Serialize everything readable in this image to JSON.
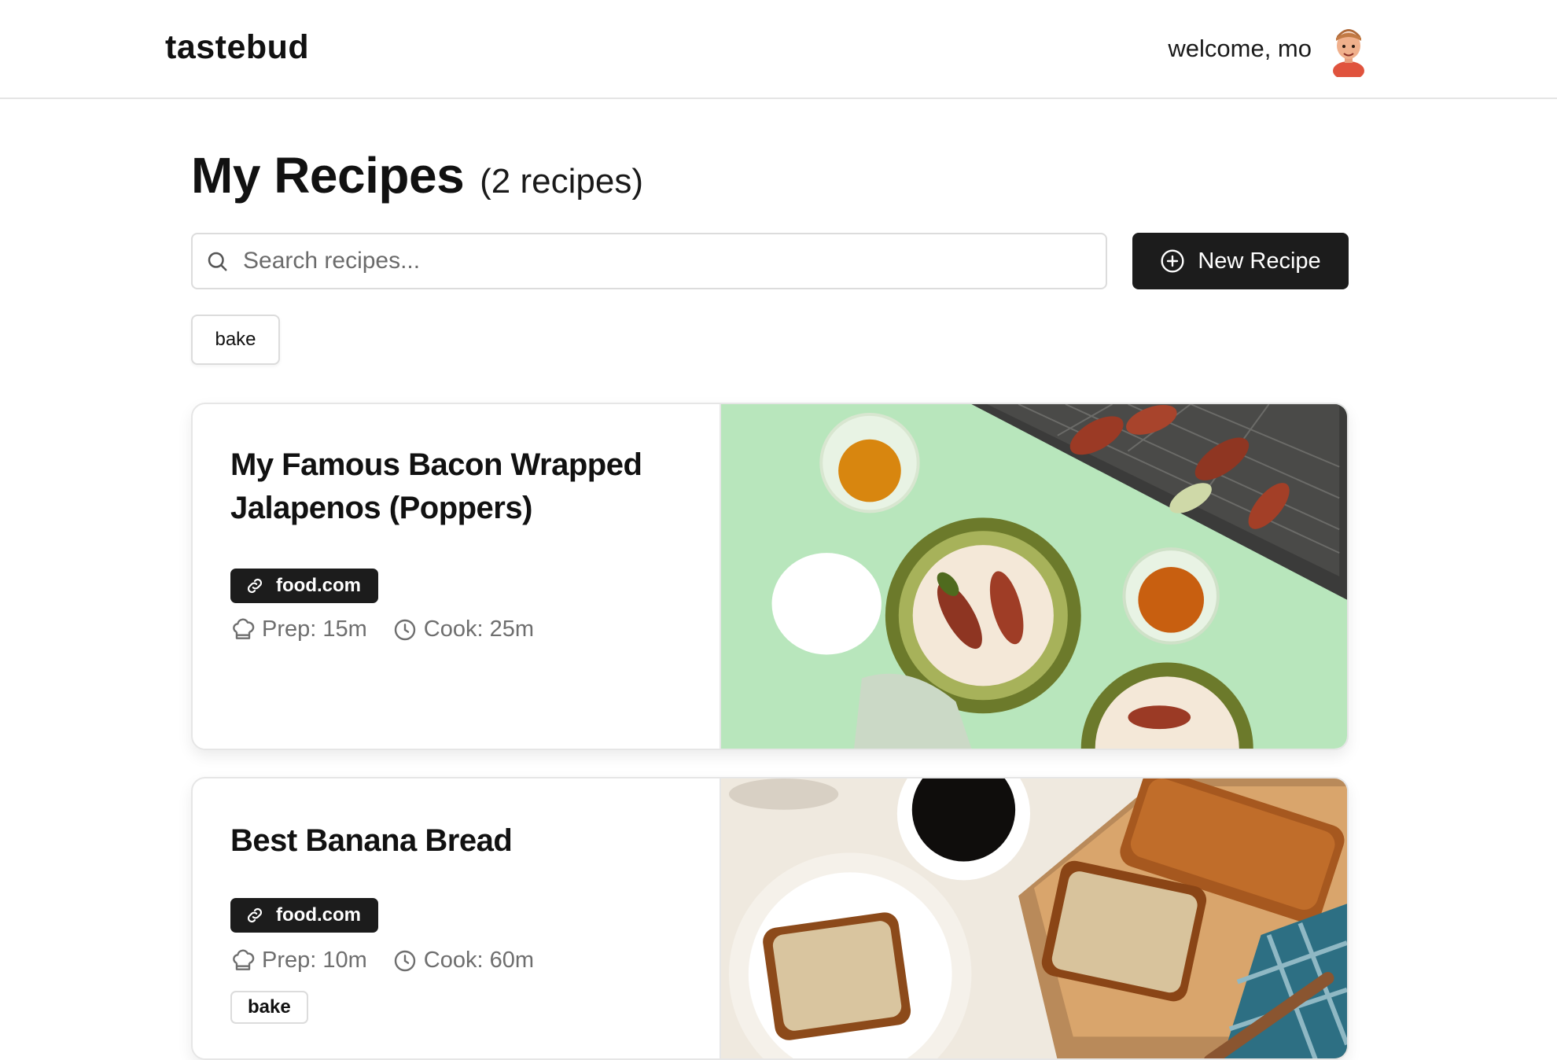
{
  "header": {
    "brand": "tastebud",
    "welcome": "welcome, mo"
  },
  "page": {
    "title": "My Recipes",
    "count": "(2 recipes)"
  },
  "search": {
    "placeholder": "Search recipes..."
  },
  "actions": {
    "new_recipe": "New Recipe"
  },
  "filters": [
    "bake"
  ],
  "recipes": [
    {
      "title": "My Famous Bacon Wrapped Jalapenos (Poppers)",
      "source": "food.com",
      "prep": "Prep: 15m",
      "cook": "Cook: 25m",
      "tags": []
    },
    {
      "title": "Best Banana Bread",
      "source": "food.com",
      "prep": "Prep: 10m",
      "cook": "Cook: 60m",
      "tags": [
        "bake"
      ]
    }
  ],
  "icons": {
    "search": "search-icon",
    "new_recipe": "plus-circle-icon",
    "source": "link-icon",
    "prep": "chef-hat-icon",
    "cook": "clock-icon"
  },
  "colors": {
    "primary_button": "#1c1c1c",
    "border": "#dcdcdc",
    "muted_text": "#6e6e6e"
  }
}
